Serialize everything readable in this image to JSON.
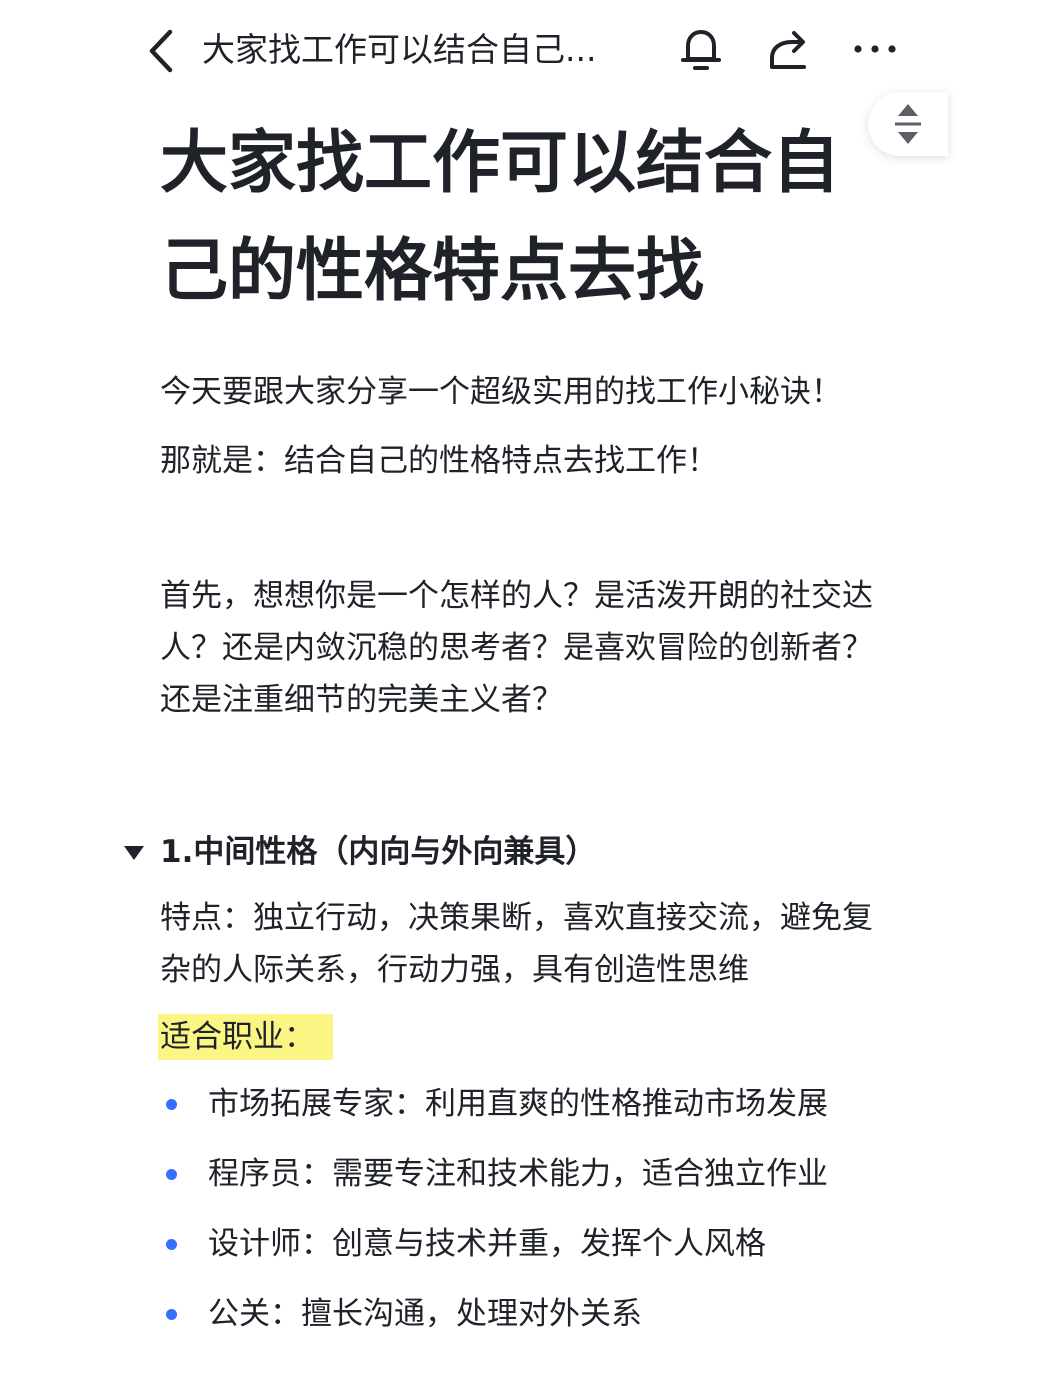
{
  "nav": {
    "title": "大家找工作可以结合自己...",
    "icons": [
      "back-chevron-icon",
      "bell-icon",
      "share-icon",
      "more-icon",
      "collapse-expand-icon"
    ]
  },
  "doc": {
    "title": "大家找工作可以结合自己的性格特点去找",
    "intro_1": "今天要跟大家分享一个超级实用的找工作小秘诀！",
    "intro_2": "那就是：结合自己的性格特点去找工作！",
    "question": "首先，想想你是一个怎样的人？是活泼开朗的社交达人？还是内敛沉稳的思考者？是喜欢冒险的创新者？还是注重细节的完美主义者？",
    "section": {
      "heading": "1.中间性格（内向与外向兼具）",
      "traits": "特点：独立行动，决策果断，喜欢直接交流，避免复杂的人际关系，行动力强，具有创造性思维",
      "suitable_label": "适合职业：",
      "jobs": [
        "市场拓展专家：利用直爽的性格推动市场发展",
        "程序员：需要专注和技术能力，适合独立作业",
        "设计师：创意与技术并重，发挥个人风格",
        "公关：擅长沟通，处理对外关系"
      ]
    }
  },
  "colors": {
    "text": "#1f2329",
    "highlight": "#fbf683",
    "bullet": "#3370ff"
  }
}
